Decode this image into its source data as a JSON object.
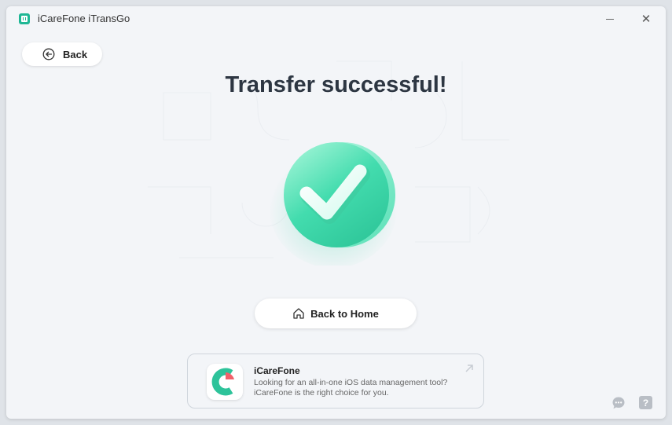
{
  "window": {
    "title": "iCareFone iTransGo",
    "minimize_glyph": "",
    "close_glyph": "✕"
  },
  "nav": {
    "back_label": "Back"
  },
  "main": {
    "headline": "Transfer successful!",
    "home_button_label": "Back to Home"
  },
  "promo": {
    "title": "iCareFone",
    "description": "Looking for an all-in-one iOS data management tool? iCareFone is the right choice for you."
  },
  "footer": {
    "help_glyph": "?"
  },
  "colors": {
    "accent": "#3fd6a8",
    "brand": "#1fb795",
    "background": "#f3f5f8",
    "headline": "#2d3642"
  },
  "icons": [
    "app-logo-icon",
    "back-arrow-icon",
    "success-check-icon",
    "home-icon",
    "icarefone-logo-icon",
    "external-arrow-icon",
    "chat-icon",
    "help-icon"
  ]
}
